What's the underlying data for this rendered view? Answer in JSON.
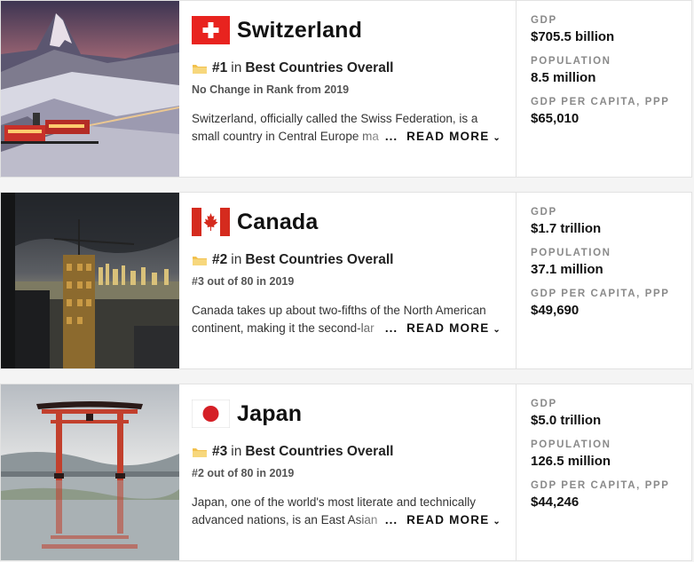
{
  "countries": [
    {
      "name": "Switzerland",
      "flag_icon": "switzerland-flag-icon",
      "rank_number": "#1",
      "rank_in": "in",
      "rank_category": "Best Countries Overall",
      "rank_change": "No Change in Rank from 2019",
      "description": "Switzerland, officially called the Swiss Federation, is a small country in Central Europe ma",
      "read_more": "READ MORE",
      "ellipsis": "...",
      "stats": [
        {
          "label": "GDP",
          "value": "$705.5 billion"
        },
        {
          "label": "POPULATION",
          "value": "8.5 million"
        },
        {
          "label": "GDP PER CAPITA, PPP",
          "value": "$65,010"
        }
      ]
    },
    {
      "name": "Canada",
      "flag_icon": "canada-flag-icon",
      "rank_number": "#2",
      "rank_in": "in",
      "rank_category": "Best Countries Overall",
      "rank_change": "#3 out of 80 in 2019",
      "description": "Canada takes up about two-fifths of the North American continent, making it the second-lar",
      "read_more": "READ MORE",
      "ellipsis": "...",
      "stats": [
        {
          "label": "GDP",
          "value": "$1.7 trillion"
        },
        {
          "label": "POPULATION",
          "value": "37.1 million"
        },
        {
          "label": "GDP PER CAPITA, PPP",
          "value": "$49,690"
        }
      ]
    },
    {
      "name": "Japan",
      "flag_icon": "japan-flag-icon",
      "rank_number": "#3",
      "rank_in": "in",
      "rank_category": "Best Countries Overall",
      "rank_change": "#2 out of 80 in 2019",
      "description": "Japan, one of the world's most literate and technically advanced nations, is an East Asian",
      "read_more": "READ MORE",
      "ellipsis": "...",
      "stats": [
        {
          "label": "GDP",
          "value": "$5.0 trillion"
        },
        {
          "label": "POPULATION",
          "value": "126.5 million"
        },
        {
          "label": "GDP PER CAPITA, PPP",
          "value": "$44,246"
        }
      ]
    }
  ],
  "colors": {
    "swiss_red": "#e8231f",
    "canada_red": "#d52b1e",
    "japan_red": "#d51f26",
    "rank_icon": "#f2c14e",
    "label_gray": "#8a8a8a"
  }
}
